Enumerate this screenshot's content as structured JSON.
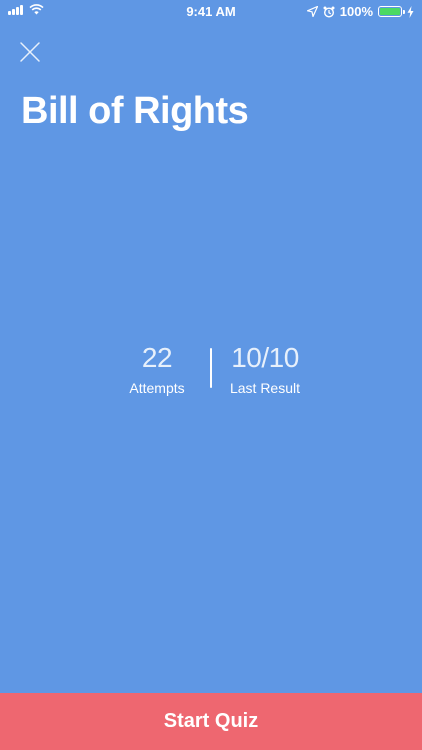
{
  "status_bar": {
    "time": "9:41 AM",
    "battery_percent": "100%",
    "battery_level": 1.0,
    "battery_color": "#4cd964",
    "icons": [
      "signal-bars-icon",
      "wifi-icon",
      "location-arrow-icon",
      "alarm-clock-icon",
      "battery-icon",
      "charging-bolt-icon"
    ]
  },
  "header": {
    "close_icon": "close-icon",
    "title": "Bill of Rights"
  },
  "stats": [
    {
      "value": "22",
      "label": "Attempts"
    },
    {
      "value": "10/10",
      "label": "Last Result"
    }
  ],
  "footer": {
    "start_label": "Start Quiz"
  },
  "colors": {
    "background": "#5f97e4",
    "accent_button": "#ee6770",
    "text": "#ffffff"
  }
}
